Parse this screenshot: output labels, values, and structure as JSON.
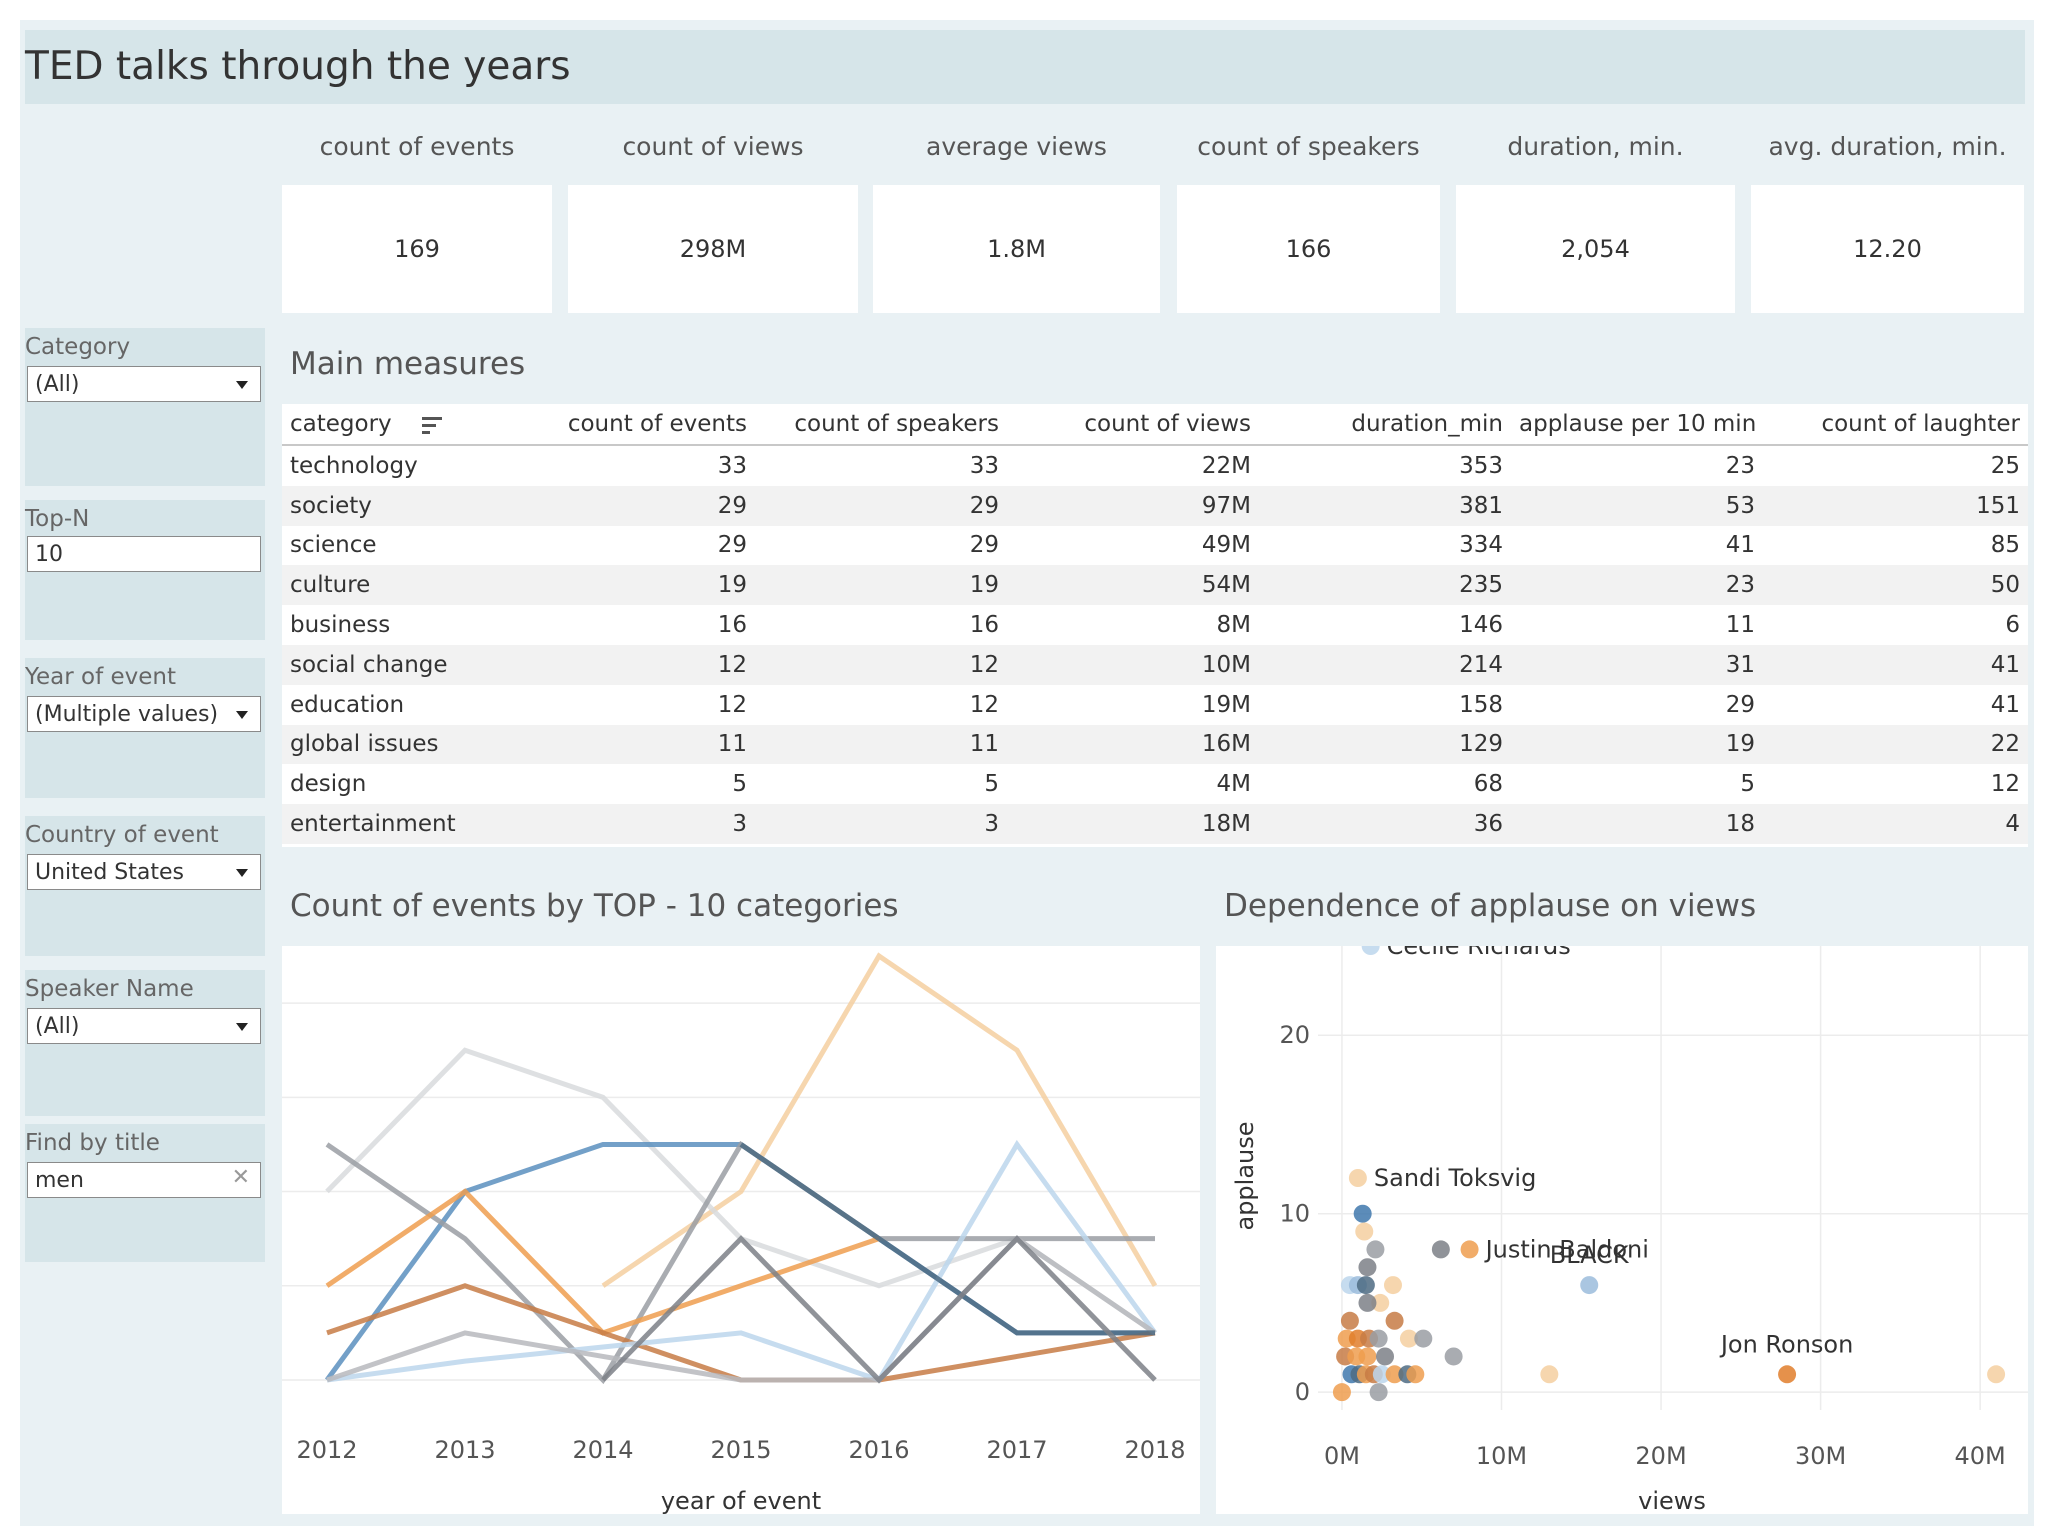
{
  "header": {
    "title": "TED talks through the years"
  },
  "kpis": [
    {
      "label": "count of events",
      "value": "169"
    },
    {
      "label": "count of views",
      "value": "298M"
    },
    {
      "label": "average views",
      "value": "1.8M"
    },
    {
      "label": "count of speakers",
      "value": "166"
    },
    {
      "label": "duration, min.",
      "value": "2,054"
    },
    {
      "label": "avg. duration, min.",
      "value": "12.20"
    }
  ],
  "filters": {
    "category": {
      "label": "Category",
      "value": "(All)"
    },
    "topn": {
      "label": "Top-N",
      "value": "10"
    },
    "year": {
      "label": "Year of event",
      "value": "(Multiple values)"
    },
    "country": {
      "label": "Country of event",
      "value": "United States"
    },
    "speaker": {
      "label": "Speaker Name",
      "value": "(All)"
    },
    "find": {
      "label": "Find by title",
      "value": "men"
    }
  },
  "table": {
    "title": "Main measures",
    "columns": [
      "category",
      "count of events",
      "count of speakers",
      "count of views",
      "duration_min",
      "applause per 10 min",
      "count of laughter"
    ],
    "rows": [
      [
        "technology",
        "33",
        "33",
        "22M",
        "353",
        "23",
        "25"
      ],
      [
        "society",
        "29",
        "29",
        "97M",
        "381",
        "53",
        "151"
      ],
      [
        "science",
        "29",
        "29",
        "49M",
        "334",
        "41",
        "85"
      ],
      [
        "culture",
        "19",
        "19",
        "54M",
        "235",
        "23",
        "50"
      ],
      [
        "business",
        "16",
        "16",
        "8M",
        "146",
        "11",
        "6"
      ],
      [
        "social change",
        "12",
        "12",
        "10M",
        "214",
        "31",
        "41"
      ],
      [
        "education",
        "12",
        "12",
        "19M",
        "158",
        "29",
        "41"
      ],
      [
        "global issues",
        "11",
        "11",
        "16M",
        "129",
        "19",
        "22"
      ],
      [
        "design",
        "5",
        "5",
        "4M",
        "68",
        "5",
        "12"
      ],
      [
        "entertainment",
        "3",
        "3",
        "18M",
        "36",
        "18",
        "4"
      ]
    ]
  },
  "line_chart": {
    "title": "Count of events by TOP - 10 categories"
  },
  "scatter_chart": {
    "title": "Dependence of applause on views"
  },
  "chart_data": [
    {
      "type": "line",
      "title": "Count of events by TOP - 10 categories",
      "xlabel": "year of event",
      "ylabel": "",
      "x": [
        2012,
        2013,
        2014,
        2015,
        2016,
        2017,
        2018
      ],
      "ylim": [
        0,
        9
      ],
      "grid": true,
      "series": [
        {
          "color": "#f5cfa0",
          "values": [
            null,
            null,
            2,
            4,
            9,
            7,
            2
          ]
        },
        {
          "color": "#d8dadd",
          "values": [
            4,
            7,
            6,
            3,
            2,
            3,
            1
          ]
        },
        {
          "color": "#5b8fbe",
          "values": [
            0,
            4,
            5,
            5,
            3,
            1,
            1
          ]
        },
        {
          "color": "#9a9ea3",
          "values": [
            5,
            3,
            0,
            5,
            3,
            3,
            3
          ]
        },
        {
          "color": "#ef9d4f",
          "values": [
            2,
            4,
            1,
            2,
            3,
            null,
            null
          ]
        },
        {
          "color": "#c77b45",
          "values": [
            1,
            2,
            1,
            0,
            0,
            0.5,
            1
          ]
        },
        {
          "color": "#bcd6ec",
          "values": [
            0,
            0.4,
            0.7,
            1,
            0,
            5,
            1
          ]
        },
        {
          "color": "#b7b9bd",
          "values": [
            0,
            1,
            0.5,
            0,
            0,
            3,
            1
          ]
        },
        {
          "color": "#4e6b82",
          "values": [
            null,
            null,
            null,
            5,
            3,
            1,
            1
          ]
        },
        {
          "color": "#7c8087",
          "values": [
            null,
            null,
            0,
            3,
            0,
            3,
            0
          ]
        }
      ]
    },
    {
      "type": "scatter",
      "title": "Dependence of applause on views",
      "xlabel": "views",
      "ylabel": "applause",
      "xlim": [
        -1500000,
        43000000
      ],
      "ylim": [
        -1,
        25
      ],
      "xticks": [
        "0M",
        "10M",
        "20M",
        "30M",
        "40M"
      ],
      "yticks": [
        "0",
        "10",
        "20"
      ],
      "grid": true,
      "points": [
        {
          "x": 1800000,
          "y": 25,
          "color": "#bcd6ec",
          "label": "Cecile Richards"
        },
        {
          "x": 1000000,
          "y": 12,
          "color": "#f5cfa0",
          "label": "Sandi Toksvig"
        },
        {
          "x": 1300000,
          "y": 10,
          "color": "#3f78ad"
        },
        {
          "x": 1400000,
          "y": 9,
          "color": "#f5cfa0"
        },
        {
          "x": 2100000,
          "y": 8,
          "color": "#9a9ea3"
        },
        {
          "x": 6200000,
          "y": 8,
          "color": "#7c8087"
        },
        {
          "x": 8000000,
          "y": 8,
          "color": "#ef9d4f",
          "label": "Justin Baldoni"
        },
        {
          "x": 15500000,
          "y": 6,
          "color": "#9bbcdc",
          "label": "BLACK"
        },
        {
          "x": 1600000,
          "y": 7,
          "color": "#7c8087"
        },
        {
          "x": 500000,
          "y": 6,
          "color": "#bcd6ec"
        },
        {
          "x": 1000000,
          "y": 6,
          "color": "#9bbcdc"
        },
        {
          "x": 1500000,
          "y": 6,
          "color": "#4e6b82"
        },
        {
          "x": 3200000,
          "y": 6,
          "color": "#f5cfa0"
        },
        {
          "x": 2400000,
          "y": 5,
          "color": "#f5cfa0"
        },
        {
          "x": 1600000,
          "y": 5,
          "color": "#7c8087"
        },
        {
          "x": 500000,
          "y": 4,
          "color": "#c77b45"
        },
        {
          "x": 3300000,
          "y": 4,
          "color": "#c77b45"
        },
        {
          "x": 300000,
          "y": 3,
          "color": "#ef9d4f"
        },
        {
          "x": 1000000,
          "y": 3,
          "color": "#e07e2c"
        },
        {
          "x": 1700000,
          "y": 3,
          "color": "#c77b45"
        },
        {
          "x": 2300000,
          "y": 3,
          "color": "#9a9ea3"
        },
        {
          "x": 4200000,
          "y": 3,
          "color": "#f5cfa0"
        },
        {
          "x": 5100000,
          "y": 3,
          "color": "#9a9ea3"
        },
        {
          "x": 200000,
          "y": 2,
          "color": "#c77b45"
        },
        {
          "x": 900000,
          "y": 2,
          "color": "#ef9d4f"
        },
        {
          "x": 1600000,
          "y": 2,
          "color": "#ef9d4f"
        },
        {
          "x": 2700000,
          "y": 2,
          "color": "#7c8087"
        },
        {
          "x": 7000000,
          "y": 2,
          "color": "#9a9ea3"
        },
        {
          "x": 600000,
          "y": 1,
          "color": "#3f78ad"
        },
        {
          "x": 1100000,
          "y": 1,
          "color": "#4e6b82"
        },
        {
          "x": 1500000,
          "y": 1,
          "color": "#ef9d4f"
        },
        {
          "x": 2000000,
          "y": 1,
          "color": "#c77b45"
        },
        {
          "x": 2500000,
          "y": 1,
          "color": "#bcd6ec"
        },
        {
          "x": 3300000,
          "y": 1,
          "color": "#ef9d4f"
        },
        {
          "x": 4100000,
          "y": 1,
          "color": "#4e6b82"
        },
        {
          "x": 4600000,
          "y": 1,
          "color": "#ef9d4f"
        },
        {
          "x": 13000000,
          "y": 1,
          "color": "#f5cfa0"
        },
        {
          "x": 27900000,
          "y": 1,
          "color": "#e07e2c",
          "label": "Jon Ronson"
        },
        {
          "x": 41000000,
          "y": 1,
          "color": "#f5cfa0"
        },
        {
          "x": 0,
          "y": 0,
          "color": "#ef9d4f"
        },
        {
          "x": 2300000,
          "y": 0,
          "color": "#9a9ea3"
        }
      ]
    }
  ]
}
